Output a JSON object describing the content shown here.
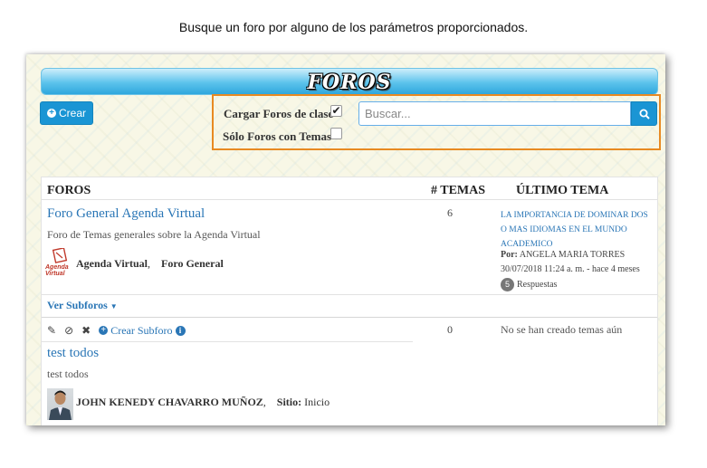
{
  "caption": "Busque un foro por alguno de los parámetros proporcionados.",
  "banner": {
    "title": "FOROS"
  },
  "toolbar": {
    "create_label": "Crear"
  },
  "filters": {
    "load_class_forums": {
      "label": "Cargar Foros de clase",
      "checked": true
    },
    "only_with_topics": {
      "label": "Sólo Foros con Temas",
      "checked": false
    },
    "search_placeholder": "Buscar..."
  },
  "table": {
    "headers": {
      "forums": "FOROS",
      "topics": "# TEMAS",
      "latest": "ÚLTIMO TEMA"
    },
    "rows": [
      {
        "title": "Foro General Agenda Virtual",
        "description": "Foro de Temas generales sobre la Agenda Virtual",
        "owner": "Agenda Virtual",
        "owner_sep": ",",
        "site_value": "Foro General",
        "logo_text": "Agenda Virtual",
        "topic_count": "6",
        "latest": {
          "title": "LA IMPORTANCIA DE DOMINAR DOS O MAS IDIOMAS EN EL MUNDO ACADEMICO",
          "author_label": "Por:",
          "author": "ANGELA MARIA TORRES",
          "date": "30/07/2018 11:24 a. m. - hace 4 meses",
          "reply_count": "5",
          "replies_label": "Respuestas"
        },
        "subforums_label": "Ver Subforos"
      },
      {
        "title": "test todos",
        "description": "test todos",
        "owner": "JOHN KENEDY CHAVARRO MUÑOZ",
        "owner_sep": ",",
        "site_label": "Sitio:",
        "site_value": "Inicio",
        "topic_count": "0",
        "latest_empty": "No se han creado temas aún",
        "create_subforum_label": "Crear Subforo"
      }
    ]
  },
  "colors": {
    "accent": "#1a95d4",
    "link": "#2a76b6",
    "highlight_border": "#e88a22"
  }
}
